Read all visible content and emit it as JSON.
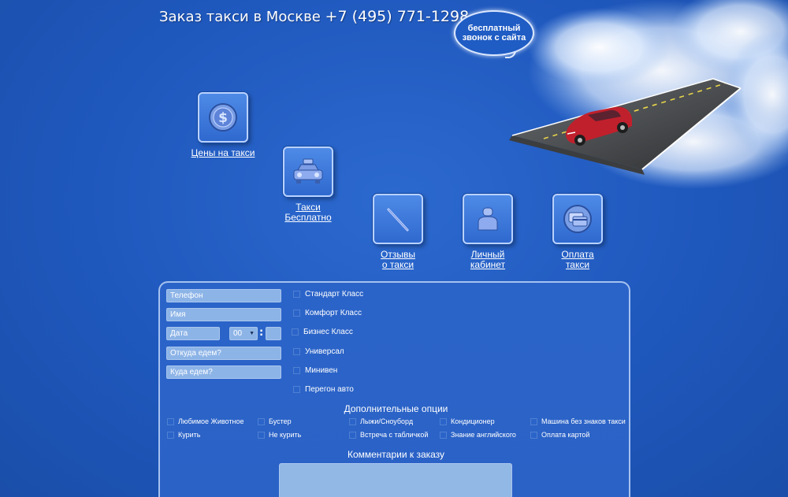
{
  "header": {
    "title": "Заказ такси в Москве",
    "phone": "+7 (495) 771-1298"
  },
  "callback": {
    "label": "бесплатный звонок с сайта"
  },
  "nav": {
    "prices": "Цены на такси",
    "free_taxi_line1": "Такси",
    "free_taxi_line2": "Бесплатно",
    "reviews_line1": "Отзывы",
    "reviews_line2": "о такси",
    "cabinet_line1": "Личный",
    "cabinet_line2": "кабинет",
    "payment_line1": "Оплата",
    "payment_line2": "такси"
  },
  "form": {
    "phone_placeholder": "Телефон",
    "name_placeholder": "Имя",
    "date_placeholder": "Дата",
    "hour_value": "00",
    "time_separator": ":",
    "from_placeholder": "Откуда едем?",
    "to_placeholder": "Куда едем?",
    "car_classes": [
      "Стандарт Класс",
      "Комфорт Класс",
      "Бизнес Класс",
      "Универсал",
      "Минивен",
      "Перегон авто"
    ],
    "options_title": "Дополнительные опции",
    "options": [
      "Любимое Животное",
      "Бустер",
      "Лыжи/Сноуборд",
      "Кондиционер",
      "Машина без знаков такси",
      "Курить",
      "Не курить",
      "Встреча с табличкой",
      "Знание английского",
      "Оплата картой"
    ],
    "comments_title": "Комментарии к заказу"
  },
  "colors": {
    "background": "#2059c0",
    "panel": "#2b64c9",
    "field": "#8db4e7",
    "car": "#c0202c"
  }
}
